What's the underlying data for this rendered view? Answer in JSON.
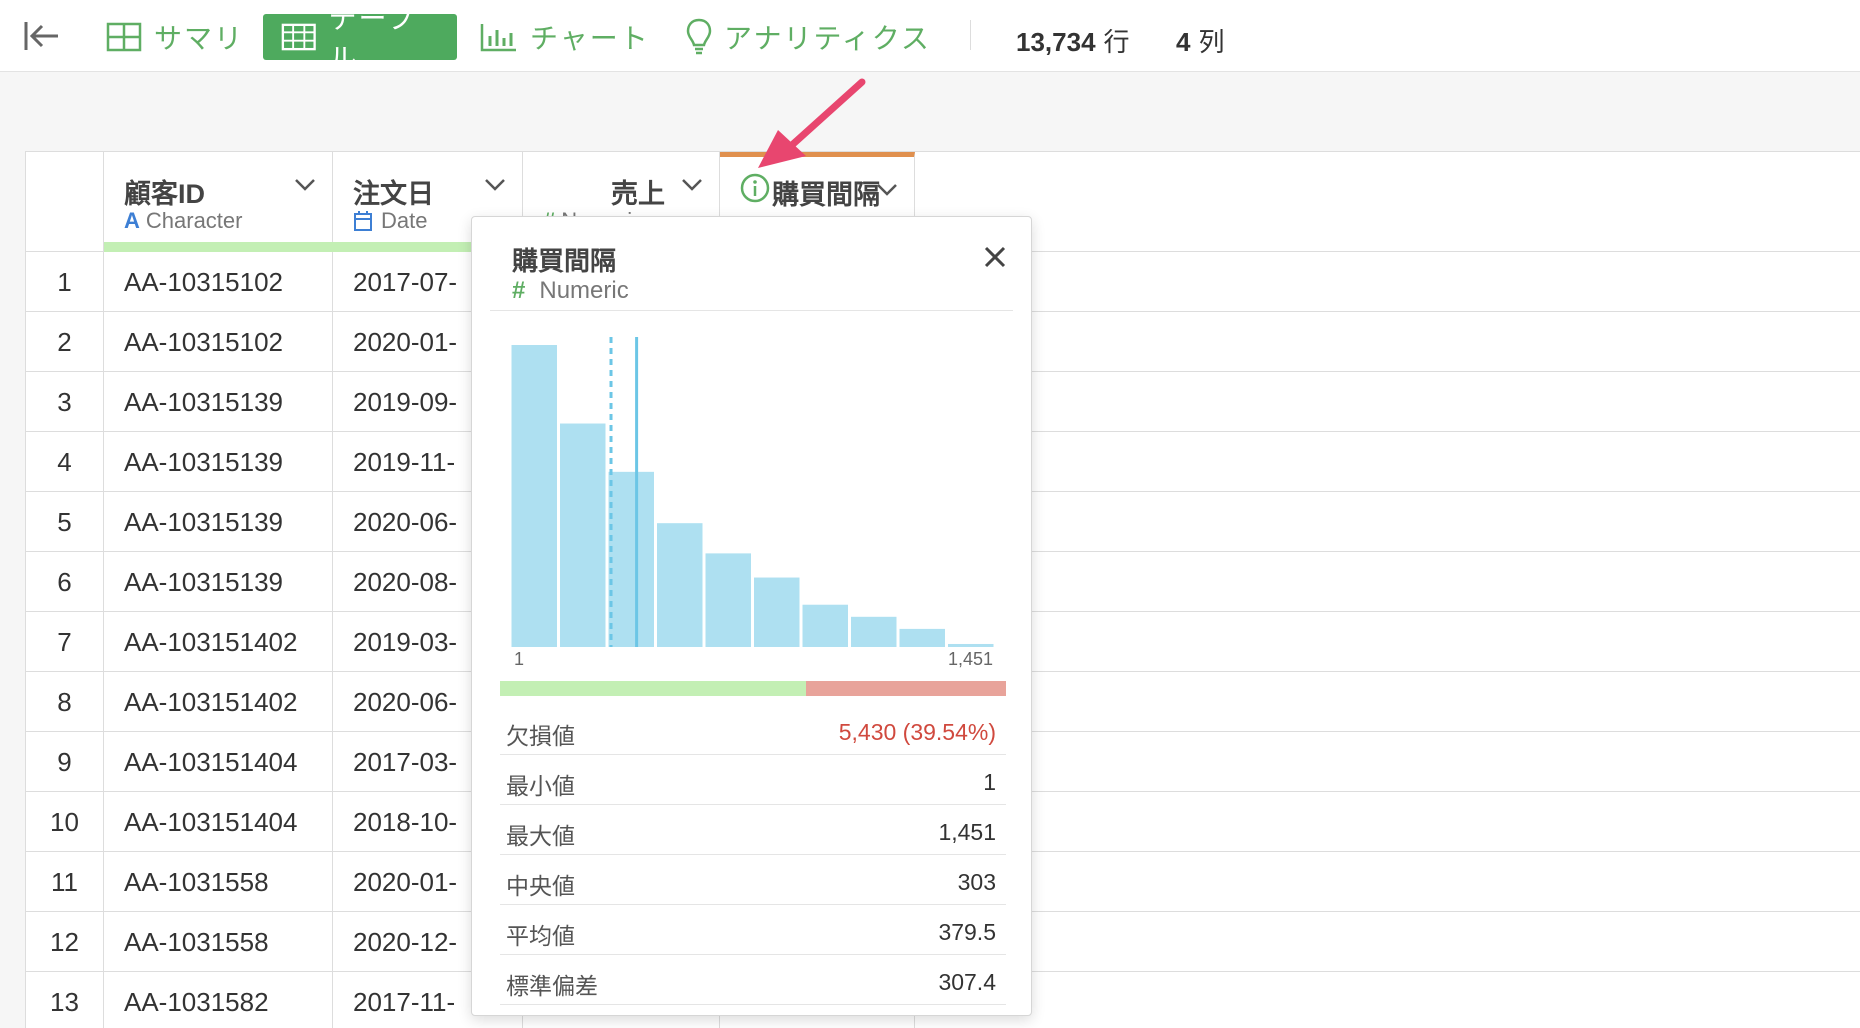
{
  "toolbar": {
    "tabs": [
      {
        "label": "サマリ",
        "icon": "grid-icon"
      },
      {
        "label": "テーブル",
        "icon": "table-icon",
        "active": true
      },
      {
        "label": "チャート",
        "icon": "bar-chart-icon"
      },
      {
        "label": "アナリティクス",
        "icon": "lightbulb-icon"
      }
    ],
    "rows_count": "13,734",
    "rows_unit": "行",
    "cols_count": "4",
    "cols_unit": "列"
  },
  "table": {
    "columns": [
      {
        "name": "顧客ID",
        "type": "Character",
        "type_icon": "A"
      },
      {
        "name": "注文日",
        "type": "Date",
        "type_icon": "calendar-icon"
      },
      {
        "name": "売上",
        "type": "Numeric",
        "type_icon": "#"
      },
      {
        "name": "購買間隔",
        "type": "Numeric",
        "type_icon": "info-icon"
      }
    ],
    "rows": [
      {
        "num": "1",
        "id": "AA-10315102",
        "date": "2017-07-"
      },
      {
        "num": "2",
        "id": "AA-10315102",
        "date": "2020-01-"
      },
      {
        "num": "3",
        "id": "AA-10315139",
        "date": "2019-09-"
      },
      {
        "num": "4",
        "id": "AA-10315139",
        "date": "2019-11-"
      },
      {
        "num": "5",
        "id": "AA-10315139",
        "date": "2020-06-"
      },
      {
        "num": "6",
        "id": "AA-10315139",
        "date": "2020-08-"
      },
      {
        "num": "7",
        "id": "AA-103151402",
        "date": "2019-03-"
      },
      {
        "num": "8",
        "id": "AA-103151402",
        "date": "2020-06-"
      },
      {
        "num": "9",
        "id": "AA-103151404",
        "date": "2017-03-"
      },
      {
        "num": "10",
        "id": "AA-103151404",
        "date": "2018-10-"
      },
      {
        "num": "11",
        "id": "AA-1031558",
        "date": "2020-01-"
      },
      {
        "num": "12",
        "id": "AA-1031558",
        "date": "2020-12-"
      },
      {
        "num": "13",
        "id": "AA-1031582",
        "date": "2017-11-"
      }
    ]
  },
  "popover": {
    "title": "購買間隔",
    "type": "Numeric",
    "type_icon": "#",
    "axis_min": "1",
    "axis_max": "1,451",
    "valid_fraction": 0.6046,
    "missing_fraction": 0.3954,
    "colors": {
      "bar": "#aee0f1",
      "line": "#6cc6e6",
      "valid": "#c3efb4",
      "missing": "#e8a39a"
    },
    "stats": [
      {
        "label": "欠損値",
        "value": "5,430 (39.54%)",
        "highlight": true
      },
      {
        "label": "最小値",
        "value": "1"
      },
      {
        "label": "最大値",
        "value": "1,451"
      },
      {
        "label": "中央値",
        "value": "303"
      },
      {
        "label": "平均値",
        "value": "379.5"
      },
      {
        "label": "標準偏差",
        "value": "307.4"
      }
    ]
  },
  "chart_data": {
    "type": "bar",
    "title": "",
    "xlim": [
      1,
      1451
    ],
    "values": [
      100,
      74,
      58,
      41,
      31,
      23,
      14,
      10,
      6,
      1
    ],
    "median": 303,
    "mean": 379.5,
    "ylabel": "",
    "xlabel": ""
  }
}
